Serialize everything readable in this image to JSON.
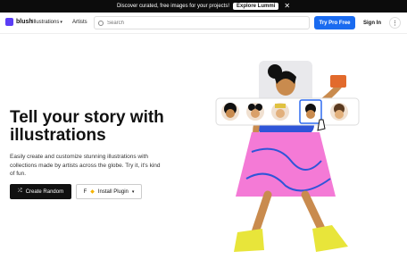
{
  "banner": {
    "text": "Discover curated, free images for your projects!",
    "button": "Explore Lummi",
    "close": "✕"
  },
  "nav": {
    "logo_text": "blush",
    "illustrations": "Illustrations",
    "artists": "Artists",
    "search_placeholder": "Search",
    "try_pro": "Try Pro Free",
    "sign_in": "Sign In",
    "more": "⋮"
  },
  "hero": {
    "title": "Tell your story with illustrations",
    "description": "Easily create and customize stunning illustrations with collections made by artists across the globe. Try it, it's kind of fun.",
    "create_random": "Create Random",
    "install_plugin": "Install Plugin"
  },
  "colors": {
    "accent": "#1a6bf0",
    "skirt": "#f47ad6",
    "shoe": "#e8e53a",
    "top": "#2f55d8",
    "skin": "#c98b4e"
  }
}
